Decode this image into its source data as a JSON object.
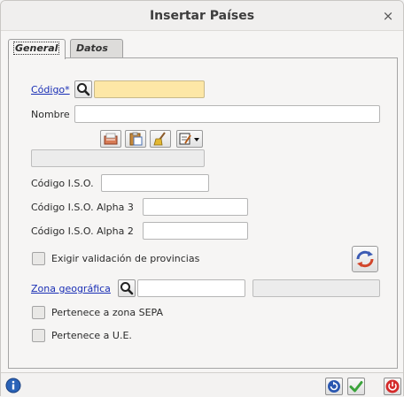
{
  "window": {
    "title": "Insertar Países",
    "close_label": "×"
  },
  "tabs": [
    {
      "label": "General"
    },
    {
      "label": "Datos"
    }
  ],
  "form": {
    "codigo": {
      "label": "Código*",
      "value": ""
    },
    "nombre": {
      "label": "Nombre",
      "value": ""
    },
    "description_value": "",
    "codigo_iso": {
      "label": "Código I.S.O.",
      "value": ""
    },
    "codigo_iso_alpha3": {
      "label": "Código I.S.O. Alpha 3",
      "value": ""
    },
    "codigo_iso_alpha2": {
      "label": "Código I.S.O. Alpha 2",
      "value": ""
    },
    "exigir_provincias": {
      "label": "Exigir validación de provincias",
      "checked": false
    },
    "zona_geografica": {
      "label": "Zona geográfica",
      "value": "",
      "description": ""
    },
    "zona_sepa": {
      "label": "Pertenece a zona SEPA",
      "checked": false
    },
    "pertenece_ue": {
      "label": "Pertenece a U.E.",
      "checked": false
    }
  },
  "icons": {
    "search": "search-icon",
    "open_folder": "open-folder-icon",
    "paste": "paste-icon",
    "clear": "broom-icon",
    "edit_menu": "edit-dropdown-icon",
    "refresh": "refresh-arrows-icon",
    "info": "info-icon",
    "reload": "reload-icon",
    "accept": "check-icon",
    "exit": "power-icon"
  },
  "colors": {
    "required_field": "#fde7a6",
    "link": "#1a2fb5",
    "info_blue": "#2a63b8",
    "accept_green": "#3aa33a",
    "exit_red": "#d42a2a"
  }
}
